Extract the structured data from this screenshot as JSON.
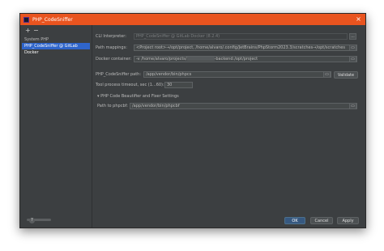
{
  "window": {
    "title": "PHP_CodeSniffer",
    "close_glyph": "×",
    "title_bar_color": "#e9541f",
    "background_color": "#3c3f41"
  },
  "sidebar": {
    "add_glyph": "+",
    "remove_glyph": "−",
    "items": [
      {
        "label": "System PHP",
        "selected": false
      },
      {
        "label": "PHP_CodeSniffer @ GitLab Docker",
        "selected": true
      }
    ],
    "selected_color": "#2f65ca"
  },
  "form": {
    "cli_interpreter": {
      "label": "CLI Interpreter:",
      "value": "PHP_CodeSniffer @ GitLab Docker (8.2.4)",
      "button": "..."
    },
    "path_mappings": {
      "label": "Path mappings:",
      "value": "<Project root>→/opt/project, /home/alvaro/.config/JetBrains/PhpStorm2023.3/scratches→/opt/scratches",
      "button": "▭"
    },
    "docker_container": {
      "label": "Docker container:",
      "value_prefix": "-v /home/alvaro/projects/",
      "value_suffix": "-backend:/opt/project",
      "button": "▭"
    },
    "codesniffer_path": {
      "label": "PHP_CodeSniffer path:",
      "value": "/app/vendor/bin/phpcs",
      "button": "▭",
      "validate": "Validate"
    },
    "timeout": {
      "label": "Tool process timeout, sec (1...60):",
      "value": "30"
    },
    "beautifier_section": {
      "arrow": "▾",
      "label": "PHP Code Beautifier and Fixer Settings"
    },
    "phpcbf_path": {
      "label": "Path to phpcbf:",
      "value": "/app/vendor/bin/phpcbf",
      "button": "▭"
    }
  },
  "footer": {
    "help": "?",
    "ok": "OK",
    "cancel": "Cancel",
    "apply": "Apply"
  }
}
